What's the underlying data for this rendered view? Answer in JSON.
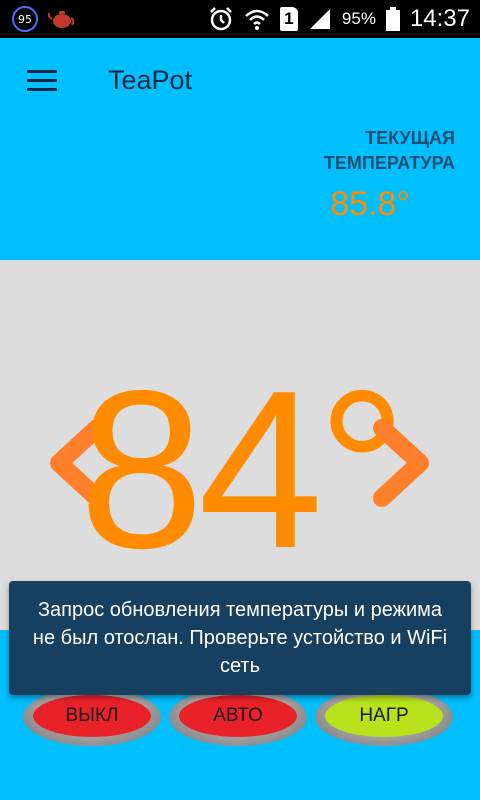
{
  "status_bar": {
    "badge": "95",
    "battery": "95%",
    "time": "14:37",
    "sim": "1",
    "icons": [
      "teapot-icon",
      "alarm-icon",
      "wifi-icon",
      "sim-icon",
      "signal-icon",
      "battery-icon"
    ]
  },
  "app_bar": {
    "title": "TeaPot",
    "menu_icon": "menu-icon"
  },
  "current": {
    "label": "ТЕКУЩАЯ\nТЕМПЕРАТУРА",
    "value": "85.8°"
  },
  "target": {
    "value": "84°",
    "decrease_icon": "chevron-left-icon",
    "increase_icon": "chevron-right-icon"
  },
  "modes": {
    "off": "ВЫКЛ",
    "auto": "АВТО",
    "heat": "НАГР"
  },
  "toast": {
    "message": "Запрос обновления температуры и режима не был отослан. Проверьте устойство и WiFi сеть"
  },
  "colors": {
    "primary": "#00BFFF",
    "accent": "#FF8C00",
    "panel": "#DDDDDD",
    "off": "#E9222A",
    "heat": "#B7E21C",
    "toast": "#173F5F"
  }
}
